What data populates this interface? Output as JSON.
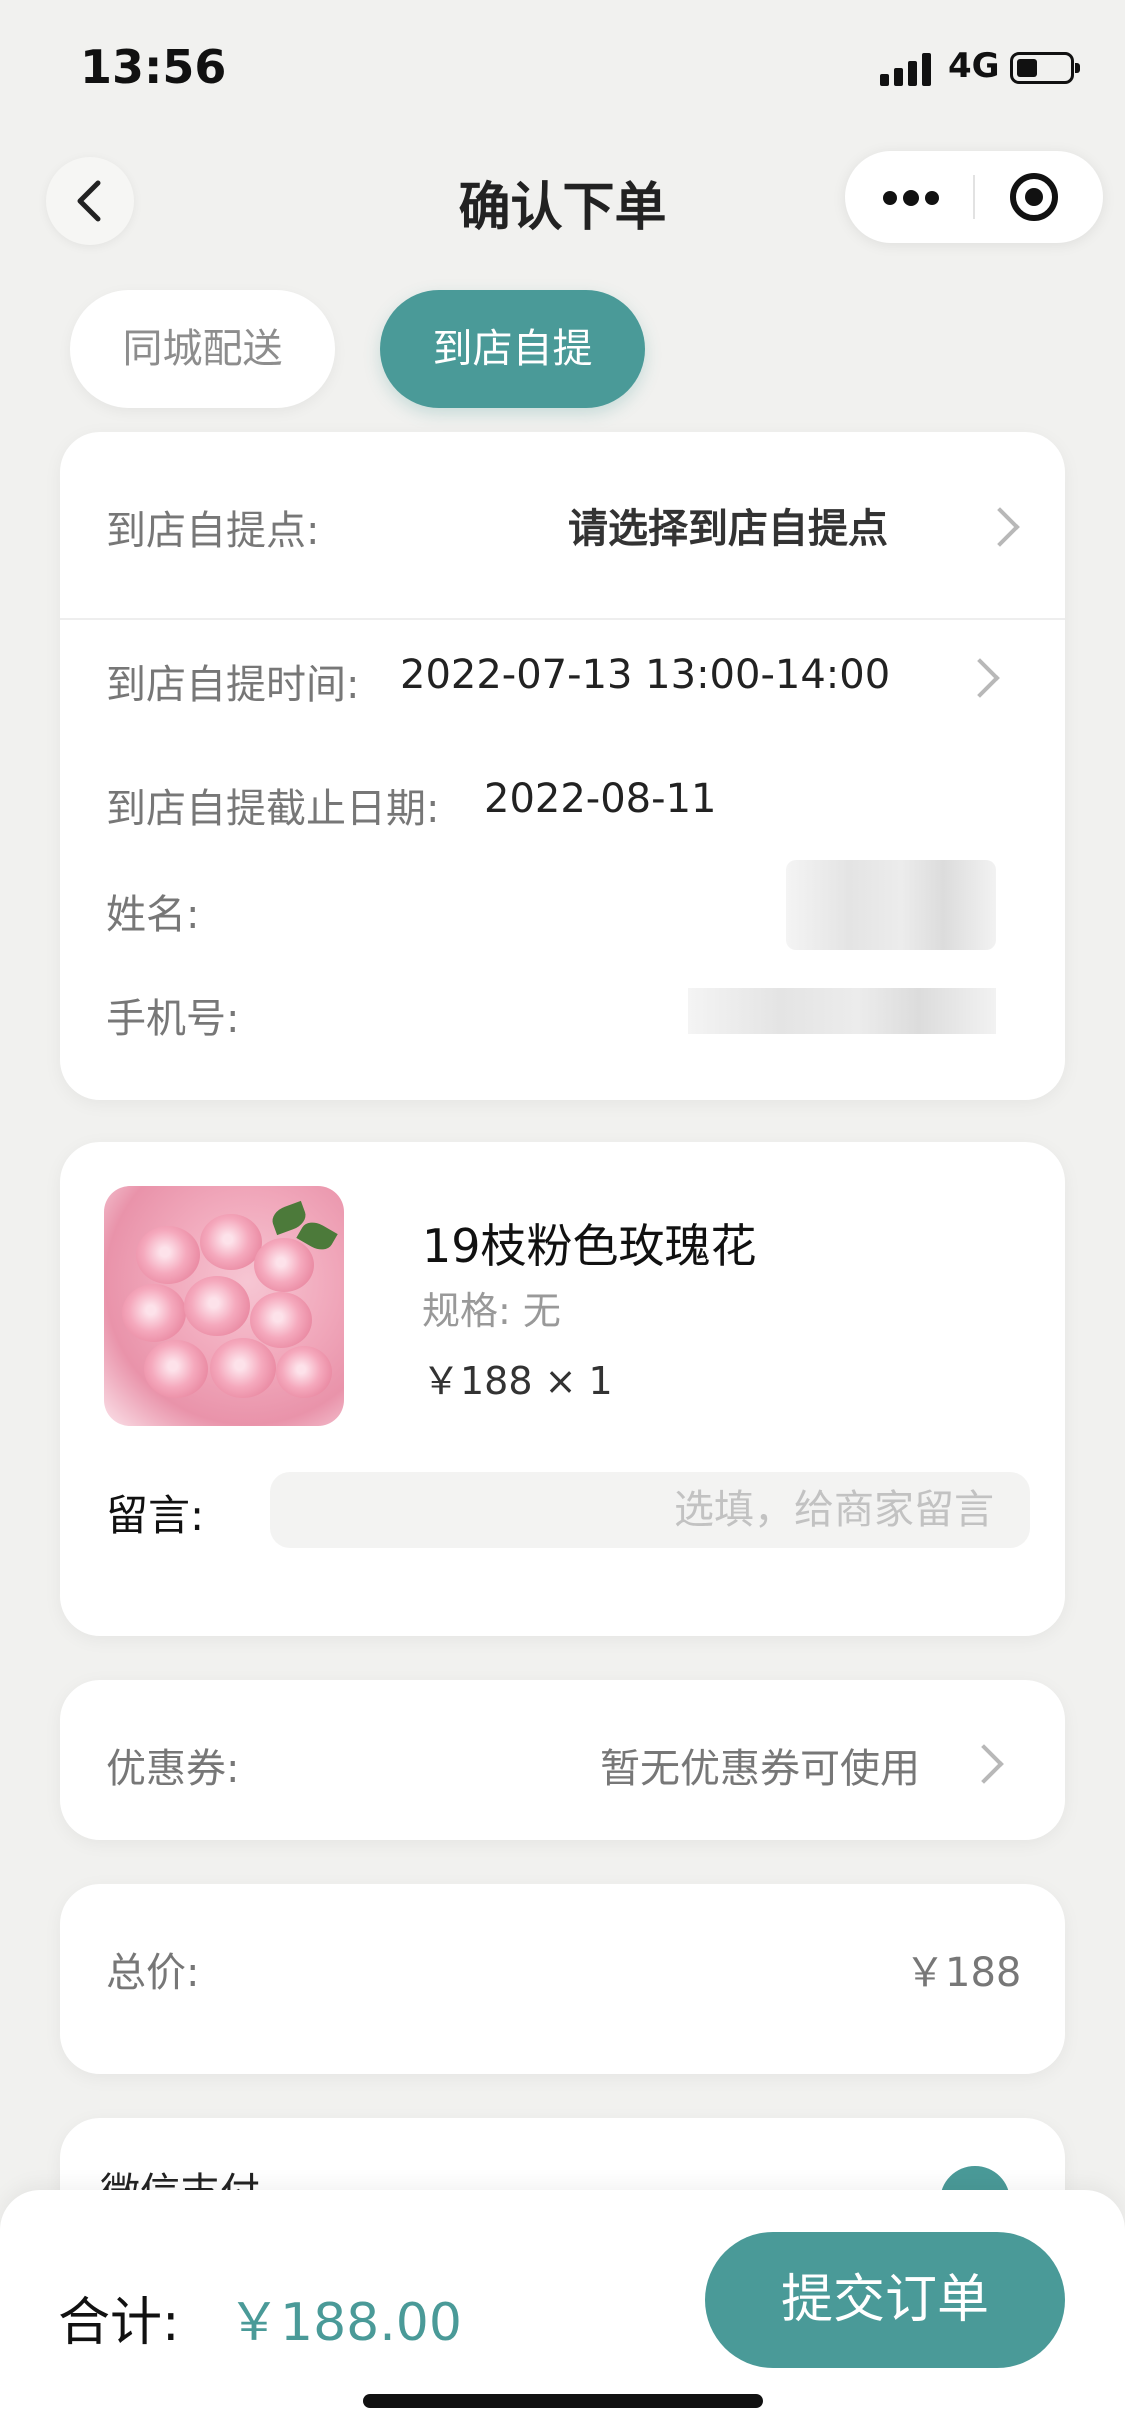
{
  "status_bar": {
    "time": "13:56",
    "network": "4G"
  },
  "navbar": {
    "title": "确认下单"
  },
  "tabs": [
    {
      "label": "同城配送",
      "active": false
    },
    {
      "label": "到店自提",
      "active": true
    }
  ],
  "pickup": {
    "point_label": "到店自提点:",
    "point_value": "请选择到店自提点",
    "time_label": "到店自提时间:",
    "time_value": "2022-07-13 13:00-14:00",
    "deadline_label": "到店自提截止日期:",
    "deadline_value": "2022-08-11",
    "name_label": "姓名:",
    "phone_label": "手机号:"
  },
  "product": {
    "name": "19枝粉色玫瑰花",
    "spec": "规格: 无",
    "price_qty": "￥188 × 1",
    "message_label": "留言:",
    "message_placeholder": "选填，给商家留言"
  },
  "coupon": {
    "label": "优惠券:",
    "value": "暂无优惠券可使用"
  },
  "total_price": {
    "label": "总价:",
    "value": "￥188"
  },
  "payment": {
    "label": "微信支付"
  },
  "bottom_bar": {
    "total_label": "合计:",
    "total_value": "￥188.00",
    "submit_label": "提交订单"
  },
  "colors": {
    "accent": "#4a9a98",
    "background": "#f1f1ef"
  }
}
